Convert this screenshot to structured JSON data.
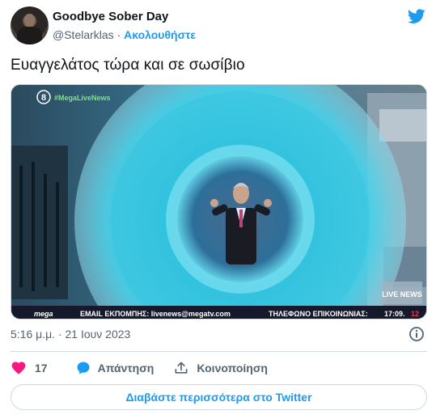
{
  "author": {
    "display_name": "Goodbye Sober Day",
    "handle": "@Stelarklas",
    "separator": "·",
    "follow_label": "Ακολουθήστε"
  },
  "tweet": {
    "text": "Ευαγγελάτος τώρα και σε σωσίβιο",
    "timestamp": "5:16 μ.μ. · 21 Ιουν 2023"
  },
  "media": {
    "channel_number": "8",
    "hashtag": "#MegaLiveNews",
    "ticker_brand": "mega",
    "ticker_email": "EMAIL ΕΚΠΟΜΠΗΣ: livenews@megatv.com",
    "ticker_phone": "ΤΗΛΕΦΩΝΟ ΕΠΙΚΟΙΝΩΝΙΑΣ:",
    "clock": "17:09.",
    "clock_suffix": "12",
    "corner_logo": "LIVE NEWS"
  },
  "actions": {
    "like_count": "17",
    "reply_label": "Απάντηση",
    "share_label": "Κοινοποίηση"
  },
  "read_more_label": "Διαβάστε περισσότερα στο Twitter",
  "colors": {
    "twitter_blue": "#1d9bf0",
    "like_pink": "#f91880",
    "text_primary": "#0f1419",
    "text_secondary": "#536471"
  },
  "icons": [
    "twitter-bird-icon",
    "info-icon",
    "heart-icon",
    "reply-bubble-icon",
    "share-upload-icon"
  ]
}
